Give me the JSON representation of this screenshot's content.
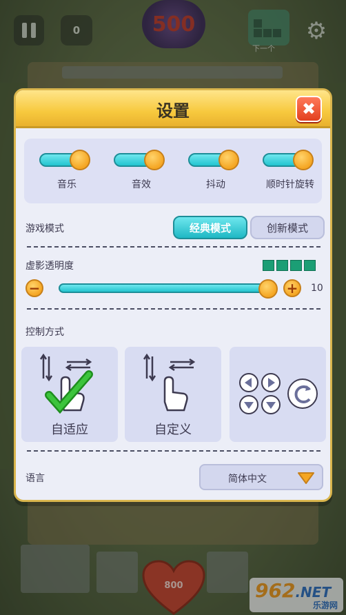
{
  "hud": {
    "moves": "0",
    "best_score": "500",
    "next_label": "下一个",
    "hearts_score": "800"
  },
  "watermark": {
    "logo_main": "962",
    "logo_suffix": ".NET",
    "sub": "乐游网"
  },
  "dialog": {
    "title": "设置",
    "close_symbol": "✖"
  },
  "toggles": [
    {
      "label": "音乐",
      "on": true
    },
    {
      "label": "音效",
      "on": true
    },
    {
      "label": "抖动",
      "on": true
    },
    {
      "label": "顺时针旋转",
      "on": true
    }
  ],
  "game_mode": {
    "label": "游戏模式",
    "options": [
      "经典模式",
      "创新模式"
    ],
    "selected": "经典模式"
  },
  "ghost_opacity": {
    "label": "虚影透明度",
    "value": "10",
    "level": 10,
    "max": 10,
    "minus": "−",
    "plus": "+"
  },
  "control": {
    "label": "控制方式",
    "options": [
      "自适应",
      "自定义",
      ""
    ],
    "selected": "自适应"
  },
  "language": {
    "label": "语言",
    "value": "简体中文"
  },
  "colors": {
    "accent_teal": "#23c4cf",
    "accent_orange": "#f5a623",
    "header_yellow": "#f7c93e",
    "close_red": "#e2401f",
    "check_green": "#3cc43c"
  }
}
